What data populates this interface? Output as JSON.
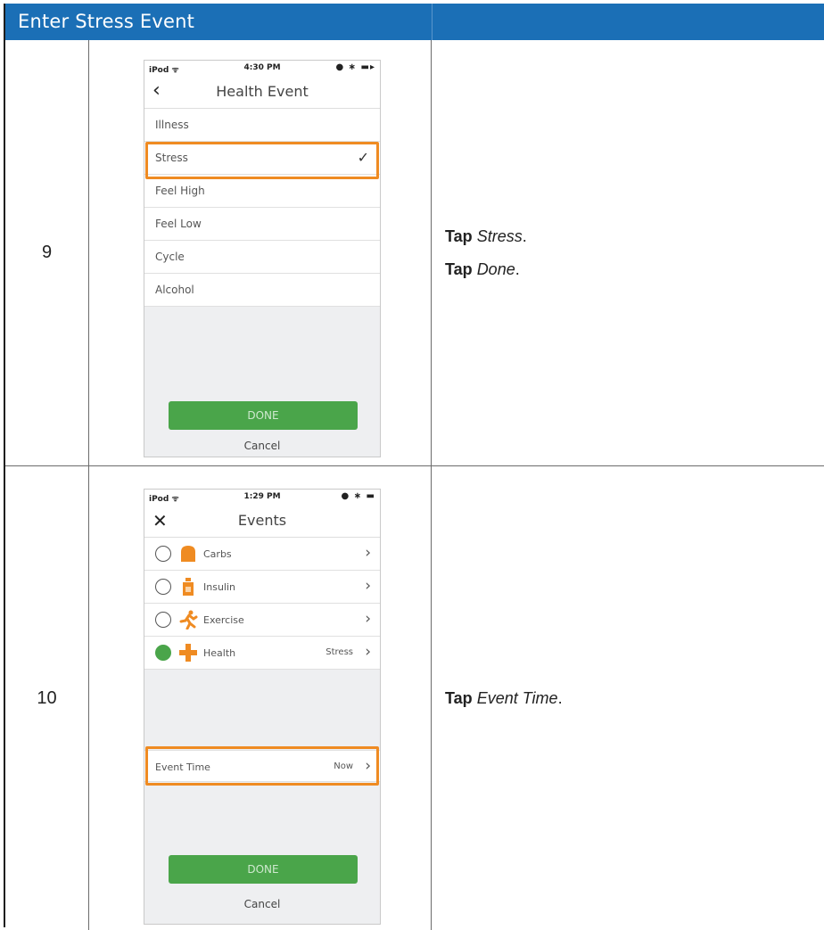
{
  "header": {
    "title": "Enter Stress Event"
  },
  "steps": [
    {
      "number": "9",
      "screen": {
        "status": {
          "carrier": "iPod",
          "time": "4:30 PM"
        },
        "nav_title": "Health Event",
        "items": [
          "Illness",
          "Stress",
          "Feel High",
          "Feel Low",
          "Cycle",
          "Alcohol"
        ],
        "selected": "Stress",
        "done_label": "DONE",
        "cancel_label": "Cancel"
      },
      "instructions": [
        {
          "verb": "Tap",
          "target": "Stress"
        },
        {
          "verb": "Tap",
          "target": "Done"
        }
      ]
    },
    {
      "number": "10",
      "screen": {
        "status": {
          "carrier": "iPod",
          "time": "1:29 PM"
        },
        "nav_title": "Events",
        "items": [
          {
            "label": "Carbs",
            "icon": "carbs-icon",
            "selected": false,
            "value": ""
          },
          {
            "label": "Insulin",
            "icon": "insulin-icon",
            "selected": false,
            "value": ""
          },
          {
            "label": "Exercise",
            "icon": "exercise-icon",
            "selected": false,
            "value": ""
          },
          {
            "label": "Health",
            "icon": "health-icon",
            "selected": true,
            "value": "Stress"
          }
        ],
        "event_time": {
          "label": "Event Time",
          "value": "Now"
        },
        "done_label": "DONE",
        "cancel_label": "Cancel"
      },
      "instructions": [
        {
          "verb": "Tap",
          "target": "Event Time"
        }
      ]
    }
  ],
  "colors": {
    "header_blue": "#1b6fb6",
    "highlight_orange": "#ef8b22",
    "done_green": "#4aa54a",
    "icon_orange": "#ef8b22"
  }
}
